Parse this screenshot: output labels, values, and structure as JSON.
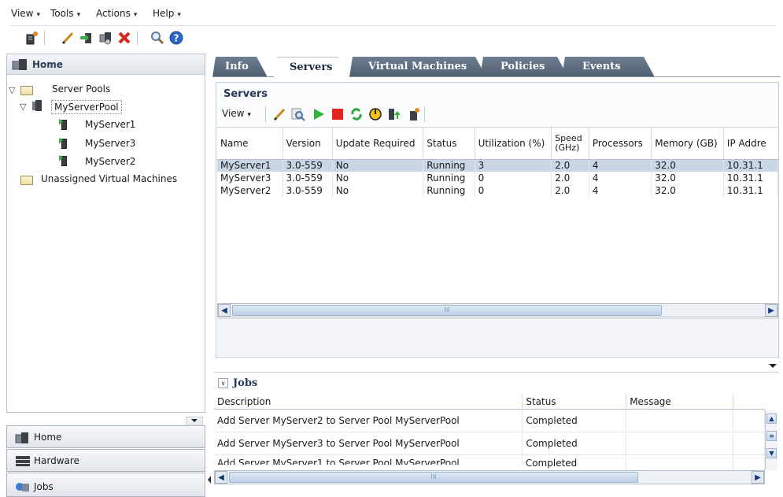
{
  "menubar": {
    "items": [
      {
        "label": "View",
        "caret": "▾"
      },
      {
        "label": "Tools",
        "caret": "▾"
      },
      {
        "label": "Actions",
        "caret": "▾"
      },
      {
        "label": "Help",
        "caret": "▾"
      }
    ]
  },
  "toolbar": {
    "icons": [
      "create-server-icon",
      "edit-icon",
      "import-icon",
      "migrate-icon",
      "delete-icon",
      "find-icon",
      "help-icon"
    ],
    "help_glyph": "?"
  },
  "left_panel": {
    "header": "Home",
    "tree": {
      "server_pools": "Server Pools",
      "pool": "MyServerPool",
      "servers": [
        "MyServer1",
        "MyServer3",
        "MyServer2"
      ],
      "unassigned": "Unassigned Virtual Machines"
    }
  },
  "nav": {
    "items": [
      {
        "label": "Home",
        "icon": "home-icon"
      },
      {
        "label": "Hardware",
        "icon": "hardware-icon"
      },
      {
        "label": "Jobs",
        "icon": "jobs-icon"
      }
    ]
  },
  "tabs": [
    {
      "label": "Info",
      "active": false
    },
    {
      "label": "Servers",
      "active": true
    },
    {
      "label": "Virtual Machines",
      "active": false
    },
    {
      "label": "Policies",
      "active": false
    },
    {
      "label": "Events",
      "active": false
    }
  ],
  "servers_panel": {
    "title": "Servers",
    "view_menu": "View",
    "columns": [
      "Name",
      "Version",
      "Update Required",
      "Status",
      "Utilization (%)",
      "Speed (GHz)",
      "Processors",
      "Memory (GB)",
      "IP Addre"
    ],
    "rows": [
      [
        "MyServer1",
        "3.0-559",
        "No",
        "Running",
        "3",
        "2.0",
        "4",
        "32.0",
        "10.31.1"
      ],
      [
        "MyServer3",
        "3.0-559",
        "No",
        "Running",
        "0",
        "2.0",
        "4",
        "32.0",
        "10.31.1"
      ],
      [
        "MyServer2",
        "3.0-559",
        "No",
        "Running",
        "0",
        "2.0",
        "4",
        "32.0",
        "10.31.1"
      ]
    ],
    "selected_row": 0,
    "scroll_glyph": "III"
  },
  "jobs_panel": {
    "title": "Jobs",
    "toggle_glyph": "∨",
    "columns": [
      "Description",
      "Status",
      "Message"
    ],
    "rows": [
      [
        "Add Server MyServer2 to Server Pool MyServerPool",
        "Completed",
        ""
      ],
      [
        "Add Server MyServer3 to Server Pool MyServerPool",
        "Completed",
        ""
      ],
      [
        "Add Server MyServer1 to Server Pool MyServerPool",
        "Completed",
        ""
      ]
    ]
  },
  "colors": {
    "tab_dark": "#55667a",
    "selection": "#c9d6e6",
    "link": "#1e4c8c"
  }
}
